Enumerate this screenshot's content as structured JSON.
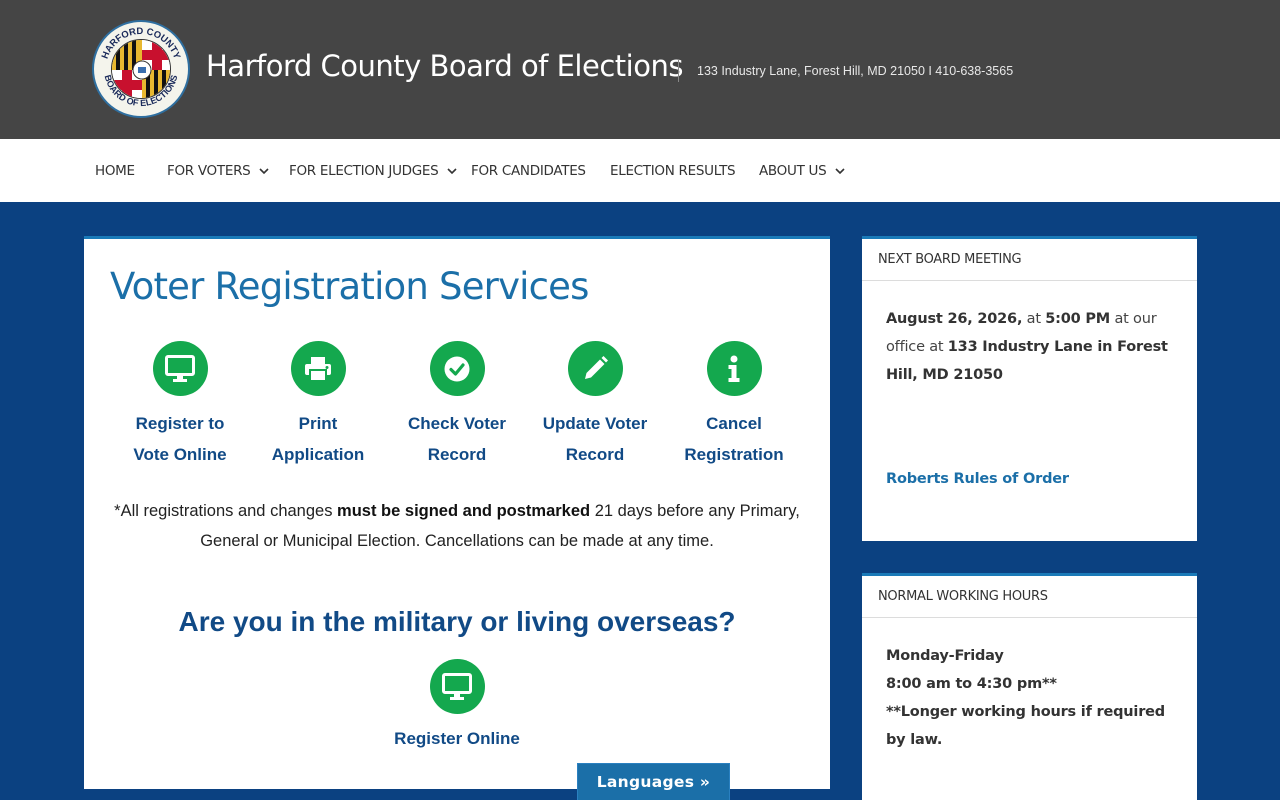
{
  "header": {
    "site_title": "Harford County Board of Elections",
    "address": "133 Industry Lane, Forest Hill, MD 21050 I 410-638-3565",
    "logo_text_top": "HARFORD COUNTY",
    "logo_text_bottom": "BOARD OF ELECTIONS"
  },
  "nav": {
    "items": [
      {
        "label": "HOME",
        "has_dropdown": false
      },
      {
        "label": "FOR VOTERS",
        "has_dropdown": true
      },
      {
        "label": "FOR ELECTION JUDGES",
        "has_dropdown": true
      },
      {
        "label": "FOR CANDIDATES",
        "has_dropdown": false
      },
      {
        "label": "ELECTION RESULTS",
        "has_dropdown": false
      },
      {
        "label": "ABOUT US",
        "has_dropdown": true
      }
    ]
  },
  "main": {
    "title": "Voter Registration Services",
    "services": [
      {
        "line1": "Register to",
        "line2": "Vote Online",
        "icon": "monitor-icon"
      },
      {
        "line1": "Print",
        "line2": "Application",
        "icon": "printer-icon"
      },
      {
        "line1": "Check Voter",
        "line2": "Record",
        "icon": "check-circle-icon"
      },
      {
        "line1": "Update Voter",
        "line2": "Record",
        "icon": "pencil-icon"
      },
      {
        "line1": "Cancel",
        "line2": "Registration",
        "icon": "info-icon"
      }
    ],
    "notice": {
      "part1": "*All registrations and changes ",
      "bold": "must be signed and postmarked",
      "part2": " 21 days before any Primary, General or Municipal Election. Cancellations can be made at any time."
    },
    "military_heading": "Are you in the military or living overseas?",
    "military_link": "Register Online"
  },
  "sidebar": {
    "meeting": {
      "heading": "NEXT BOARD MEETING",
      "date": "August 26, 2026,",
      "at1": " at ",
      "time": "5:00 PM",
      "at2": " at our office at ",
      "location": "133 Industry Lane in Forest Hill, MD 21050",
      "link": "Roberts Rules of Order"
    },
    "hours": {
      "heading": "NORMAL WORKING HOURS",
      "days": "Monday-Friday",
      "time": "8:00 am to 4:30 pm**",
      "note": "**Longer working hours if required by law."
    }
  },
  "language_button": "Languages »",
  "colors": {
    "header_bg": "#454545",
    "page_bg": "#0b4181",
    "accent_blue": "#1b6fa8",
    "icon_green": "#14a84e",
    "link_navy": "#114a86"
  }
}
